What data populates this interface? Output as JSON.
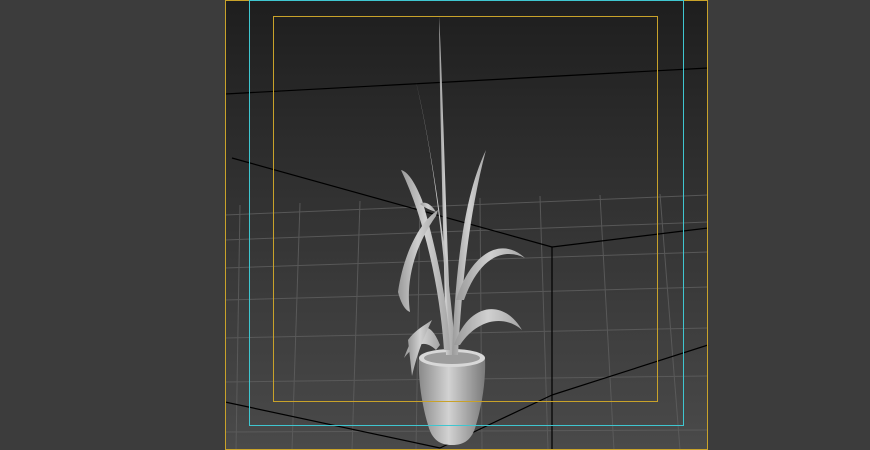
{
  "viewport": {
    "background_color": "#3c3c3c",
    "render_region_fill_top": "#1e1e1e",
    "render_region_fill_bottom": "#4a4a4a",
    "frame_colors": {
      "render_frame": "#c8a22a",
      "safe_frame_action": "#3fc6d0",
      "safe_frame_title": "#c8a22a"
    },
    "grid_color": "#5a5a5a",
    "edge_color": "#000000",
    "object_color": "#bdbdbd"
  }
}
